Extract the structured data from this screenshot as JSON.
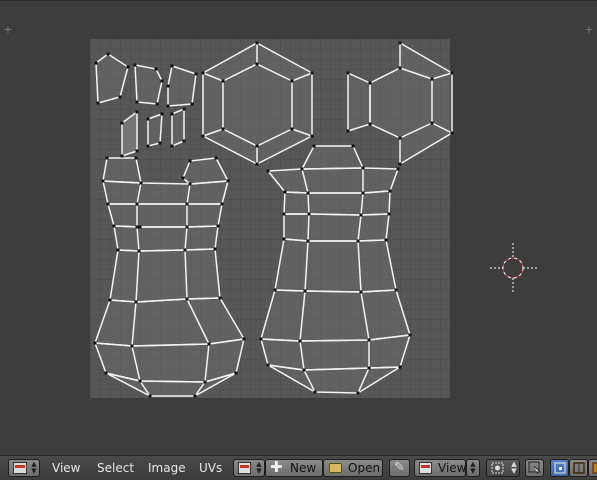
{
  "header": {
    "menus": [
      "View",
      "Select",
      "Image",
      "UVs"
    ],
    "new_label": "New",
    "open_label": "Open",
    "view_label": "View",
    "icons": {
      "editor_type": "image-editor-icon",
      "image_browse": "image-icon",
      "new": "plus-icon",
      "open": "folder-icon",
      "pin": "pin-icon",
      "view_mode": "image-icon",
      "pivot": "pivot-point-icon",
      "sync": "uv-sync-icon",
      "select_mode": "vertex-select-icon"
    }
  },
  "colors": {
    "editor_bg": "#3d3d3d",
    "image_bg": "#555555",
    "uv_edge": "#ffffff",
    "cursor": "#e74c3c",
    "header_bg": "#454545",
    "active_button": "#4a74b8"
  }
}
